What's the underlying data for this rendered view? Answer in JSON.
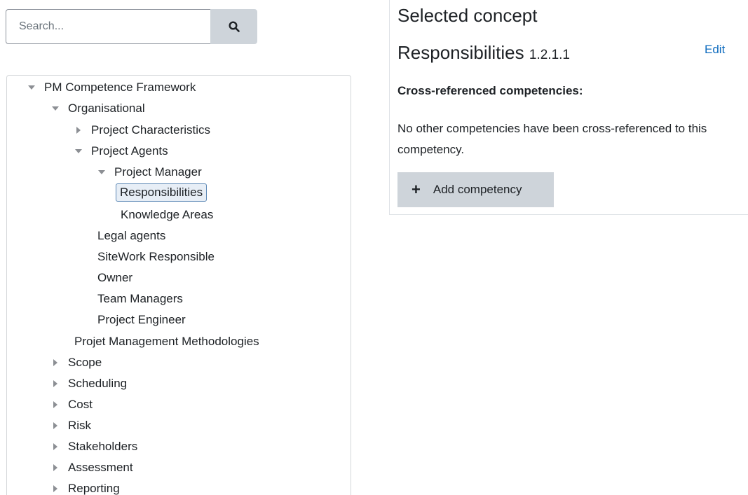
{
  "search": {
    "placeholder": "Search...",
    "icon": "search-icon"
  },
  "tree": {
    "root": "PM Competence Framework",
    "organisational": "Organisational",
    "project_characteristics": "Project Characteristics",
    "project_agents": "Project Agents",
    "project_manager": "Project Manager",
    "responsibilities": "Responsibilities",
    "knowledge_areas": "Knowledge Areas",
    "legal_agents": "Legal agents",
    "sitework_responsible": "SiteWork Responsible",
    "owner": "Owner",
    "team_managers": "Team Managers",
    "project_engineer": "Project Engineer",
    "methodologies": "Projet Management Methodologies",
    "scope": "Scope",
    "scheduling": "Scheduling",
    "cost": "Cost",
    "risk": "Risk",
    "stakeholders": "Stakeholders",
    "assessment": "Assessment",
    "reporting": "Reporting"
  },
  "detail": {
    "title": "Selected concept",
    "concept_name": "Responsibilities",
    "concept_id": "1.2.1.1",
    "edit_label": "Edit",
    "crossref_heading": "Cross-referenced competencies:",
    "crossref_text": "No other competencies have been cross-referenced to this competency.",
    "add_label": "Add competency"
  },
  "colors": {
    "accent_link": "#0f6cbf",
    "button_bg": "#ced4da",
    "selected_border": "#5b87b5"
  }
}
